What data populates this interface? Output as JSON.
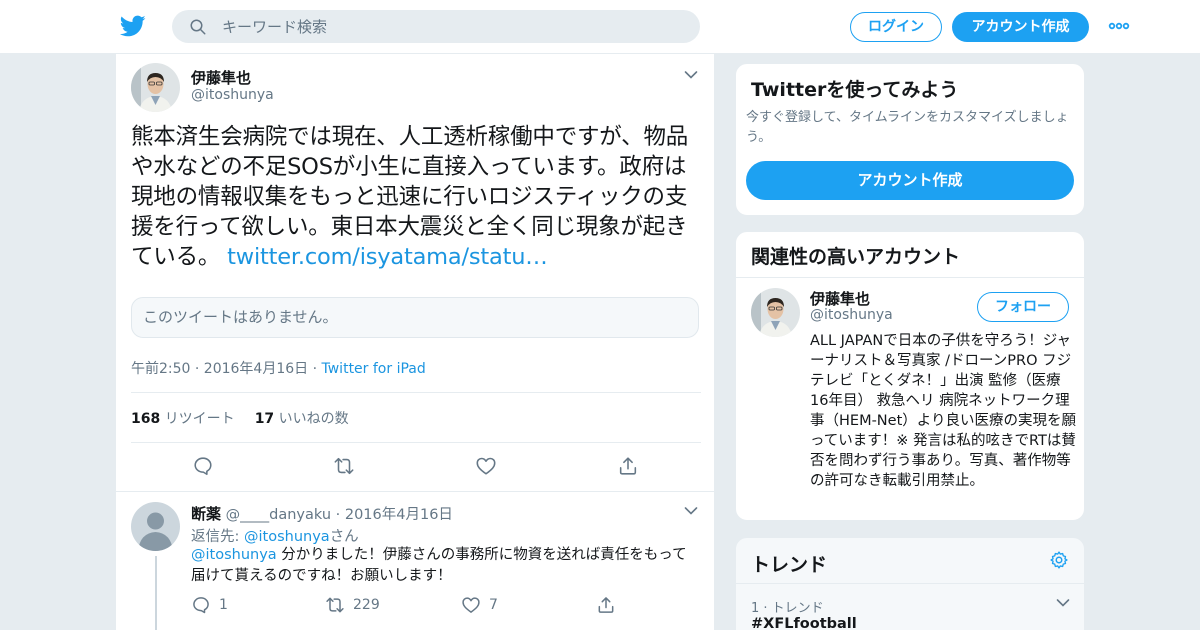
{
  "header": {
    "search_placeholder": "キーワード検索",
    "login_label": "ログイン",
    "signup_label": "アカウント作成",
    "brand_color": "#1da1f2"
  },
  "tweet": {
    "author_name": "伊藤隼也",
    "author_handle": "@itoshunya",
    "text": "熊本済生会病院では現在、人工透析稼働中ですが、物品や水などの不足SOSが小生に直接入っています。政府は現地の情報収集をもっと迅速に行いロジスティックの支援を行って欲しい。東日本大震災と全く同じ現象が起きている。",
    "link_text": "twitter.com/isyatama/statu…",
    "quote_unavailable": "このツイートはありません。",
    "time": "午前2:50 · 2016年4月16日 · ",
    "source": "Twitter for iPad",
    "retweet_count": "168",
    "retweet_label": "リツイート",
    "like_count": "17",
    "like_label": "いいねの数"
  },
  "reply": {
    "author_name": "断薬",
    "author_handle": "@____danyaku",
    "date": "· 2016年4月16日",
    "reply_to_prefix": "返信先: ",
    "reply_to_handle": "@itoshunya",
    "reply_to_suffix": "さん",
    "mention": "@itoshunya",
    "text": " 分かりました！伊藤さんの事務所に物資を送れば責任をもって届けて貰えるのですね！お願いします！",
    "reply_count": "1",
    "retweet_count": "229",
    "like_count": "7"
  },
  "sidebar": {
    "signup_card": {
      "title": "Twitterを使ってみよう",
      "description": "今すぐ登録して、タイムラインをカスタマイズしましょう。",
      "button": "アカウント作成"
    },
    "related": {
      "title": "関連性の高いアカウント",
      "name": "伊藤隼也",
      "handle": "@itoshunya",
      "follow_label": "フォロー",
      "bio": "ALL JAPANで日本の子供を守ろう！ジャーナリスト＆写真家 /ドローンPRO フジテレビ「とくダネ！」出演 監修（医療 16年目） 救急ヘリ 病院ネットワーク理事（HEM-Net）より良い医療の実現を願っています！※ 発言は私的呟きでRTは賛否を問わず行う事あり。写真、著作物等の許可なき転載引用禁止。"
    },
    "trends": {
      "title": "トレンド",
      "items": [
        {
          "meta": "1 · トレンド",
          "name": "#XFLfootball"
        }
      ]
    }
  },
  "icons": {
    "logo": "twitter-bird-icon",
    "search": "search-icon",
    "more": "more-dots-icon",
    "reply": "reply-icon",
    "retweet": "retweet-icon",
    "like": "heart-icon",
    "share": "share-icon",
    "settings": "gear-icon",
    "caret": "chevron-down-icon"
  }
}
